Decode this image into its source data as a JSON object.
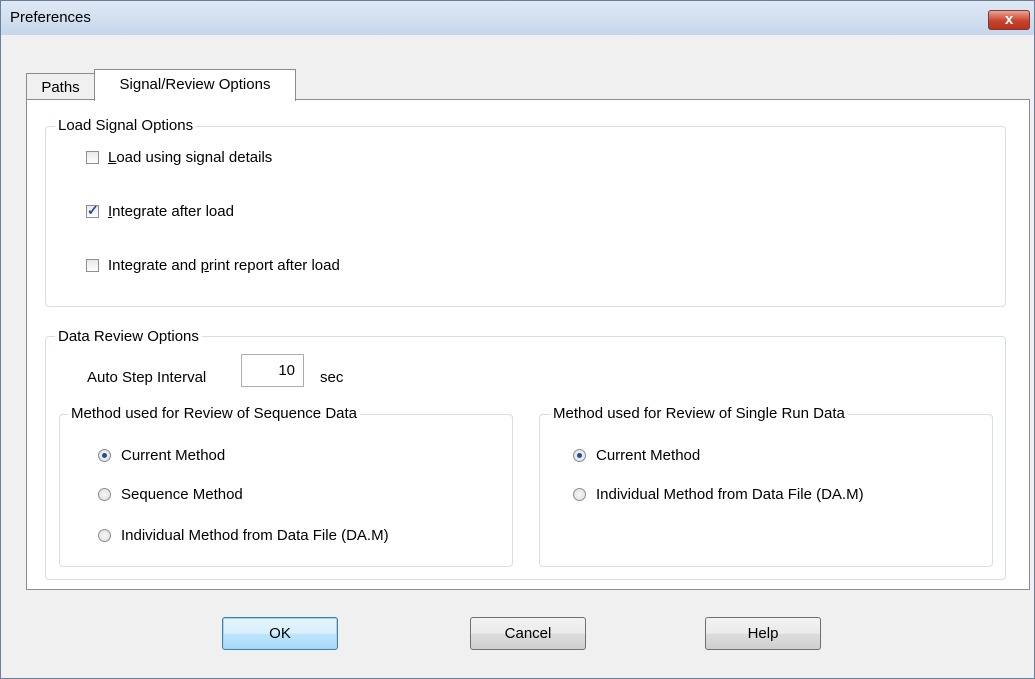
{
  "window": {
    "title": "Preferences",
    "close_label": "x"
  },
  "tabs": [
    {
      "label": "Paths",
      "active": false
    },
    {
      "label": "Signal/Review Options",
      "active": true
    }
  ],
  "load_signal": {
    "legend": "Load Signal Options",
    "options": [
      {
        "mnemonic": "L",
        "rest": "oad using signal details",
        "checked": false
      },
      {
        "mnemonic": "I",
        "rest": "ntegrate after load",
        "checked": true
      },
      {
        "before": "Integrate and ",
        "mnemonic": "p",
        "rest": "rint report after load",
        "checked": false
      }
    ]
  },
  "data_review": {
    "legend": "Data Review Options",
    "auto_step_label": "Auto Step Interval",
    "auto_step_value": "10",
    "auto_step_unit": "sec",
    "sequence_group": {
      "legend": "Method used for Review of Sequence Data",
      "options": [
        {
          "label": "Current Method",
          "selected": true
        },
        {
          "label": "Sequence Method",
          "selected": false
        },
        {
          "label": "Individual Method from Data File (DA.M)",
          "selected": false
        }
      ]
    },
    "single_run_group": {
      "legend": "Method used for Review of Single Run Data",
      "options": [
        {
          "label": "Current Method",
          "selected": true
        },
        {
          "label": "Individual Method from Data File (DA.M)",
          "selected": false
        }
      ]
    }
  },
  "buttons": {
    "ok": "OK",
    "cancel": "Cancel",
    "help": "Help"
  }
}
